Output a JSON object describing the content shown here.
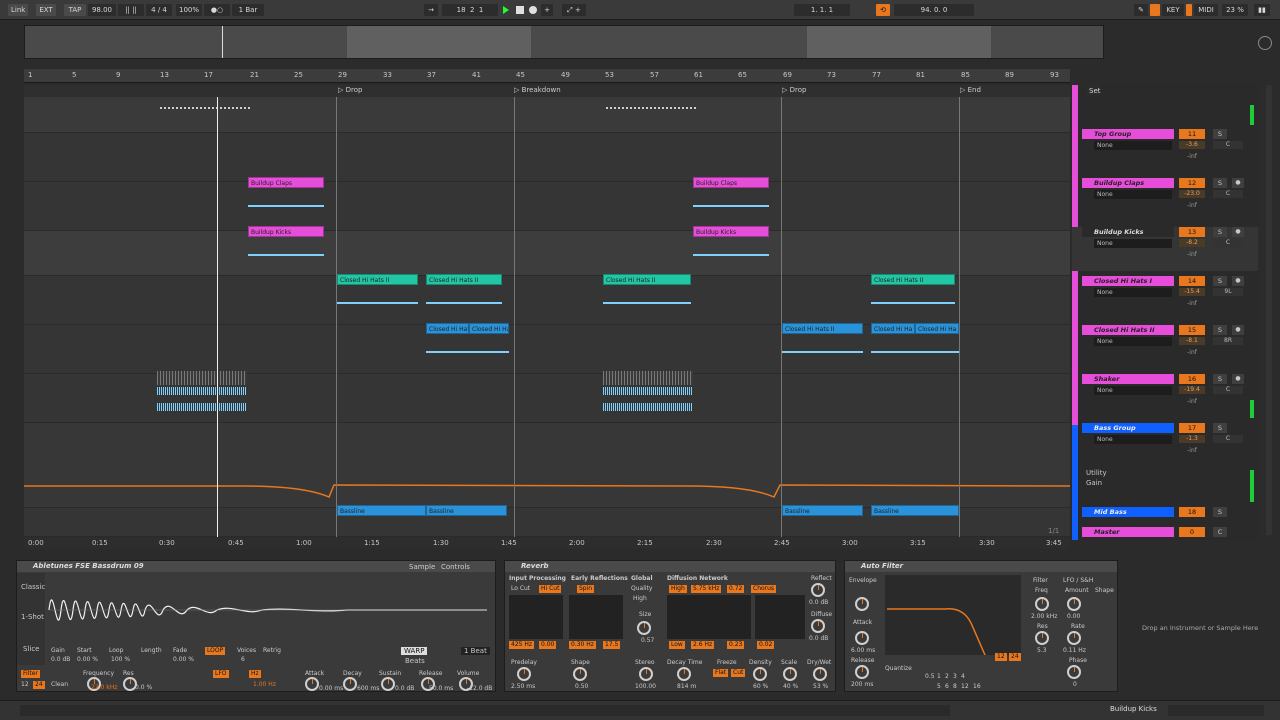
{
  "transport": {
    "link": "Link",
    "ext": "EXT",
    "tap": "TAP",
    "tempo": "98.00",
    "sig": "4 / 4",
    "zoom": "100%",
    "quant": "1 Bar",
    "pos1": "18",
    "pos2": "2",
    "pos3": "1",
    "loopstart": "1.   1.   1",
    "looplen": "94.   0.   0",
    "key": "KEY",
    "midi": "MIDI",
    "cpu": "23 %"
  },
  "ruler": {
    "bars": [
      "1",
      "5",
      "9",
      "13",
      "17",
      "21",
      "25",
      "29",
      "33",
      "37",
      "41",
      "45",
      "49",
      "53",
      "57",
      "61",
      "65",
      "69",
      "73",
      "77",
      "81",
      "85",
      "89",
      "93"
    ]
  },
  "locators": [
    "Drop",
    "Breakdown",
    "Drop",
    "End"
  ],
  "timeruler": [
    "0:00",
    "0:15",
    "0:30",
    "0:45",
    "1:00",
    "1:15",
    "1:30",
    "1:45",
    "2:00",
    "2:15",
    "2:30",
    "2:45",
    "3:00",
    "3:15",
    "3:30",
    "3:45"
  ],
  "clips": {
    "buildup_claps": "Buildup Claps",
    "buildup_kicks": "Buildup Kicks",
    "closed1": "Closed Hi Hats II",
    "closed2": "Closed Hi Hats II",
    "closed2b": "Closed Hi Hats II",
    "closed_hi_hat": "Closed Hi Hat",
    "closed_hi_ha": "Closed Hi Ha",
    "bassline": "Bassline"
  },
  "mixer": {
    "tracks": [
      {
        "name": "Top Group",
        "num": "11",
        "vol": "-3.6",
        "pan": "C",
        "color": "pink"
      },
      {
        "name": "Buildup Claps",
        "num": "12",
        "vol": "-23.0",
        "pan": "C",
        "color": "pink"
      },
      {
        "name": "Buildup Kicks",
        "num": "13",
        "vol": "-8.2",
        "pan": "C",
        "color": "none"
      },
      {
        "name": "Closed Hi Hats I",
        "num": "14",
        "vol": "-15.4",
        "pan": "9L",
        "color": "pink"
      },
      {
        "name": "Closed Hi Hats II",
        "num": "15",
        "vol": "-8.1",
        "pan": "8R",
        "color": "pink"
      },
      {
        "name": "Shaker",
        "num": "16",
        "vol": "-19.4",
        "pan": "C",
        "color": "pink"
      },
      {
        "name": "Bass Group",
        "num": "17",
        "vol": "-1.3",
        "pan": "C",
        "color": "blue"
      }
    ],
    "none": "None",
    "inf": "-inf",
    "solo": "S",
    "utility": "Utility",
    "gain": "Gain",
    "mid_bass": "Mid Bass",
    "mid_bass_num": "18",
    "master": "Master",
    "master_num": "0",
    "master_pan": "C",
    "set": "Set",
    "fraction": "1/1"
  },
  "simpler": {
    "title": "Abletunes FSE Bassdrum 09",
    "tab_sample": "Sample",
    "tab_controls": "Controls",
    "classic": "Classic",
    "oneshot": "1-Shot",
    "slice": "Slice",
    "gain": "Gain",
    "start": "Start",
    "loop": "Loop",
    "length": "Length",
    "fade": "Fade",
    "loop_btn": "LOOP",
    "voices": "Voices",
    "retrig": "Retrig",
    "warp": "WARP",
    "beat": "1 Beat",
    "beats": "Beats",
    "gain_v": "0.0 dB",
    "start_v": "0.00 %",
    "length_v": "100 %",
    "fade_v": "0.00 %",
    "voices_v": "6",
    "filter": "Filter",
    "frequency": "Frequency",
    "res": "Res",
    "clean": "Clean",
    "freq_v": "22.0 kHz",
    "res_v": "0.0 %",
    "lfo": "LFO",
    "hz": "Hz",
    "lfo_v": "1.00 Hz",
    "attack": "Attack",
    "decay": "Decay",
    "sustain": "Sustain",
    "release": "Release",
    "volume": "Volume",
    "attack_v": "0.00 ms",
    "decay_v": "600 ms",
    "sustain_v": "0.0 dB",
    "release_v": "50.0 ms",
    "volume_v": "-12.0 dB",
    "f12": "12",
    "f24": "24"
  },
  "reverb": {
    "title": "Reverb",
    "input": "Input Processing",
    "locut": "Lo Cut",
    "hicut": "Hi Cut",
    "early": "Early Reflections",
    "spin": "Spin",
    "global": "Global",
    "quality": "Quality",
    "high": "High",
    "size": "Size",
    "size_v": "0.57",
    "diffusion": "Diffusion Network",
    "high2": "High",
    "dnv": "5.75 kHz",
    "dnv2": "0.72",
    "chorus": "Chorus",
    "reflect": "Reflect",
    "reflect_v": "0.0 dB",
    "diffuse": "Diffuse",
    "diffuse_v": "0.0 dB",
    "low": "Low",
    "lowv": "2.6 Hz",
    "low2": "0.23",
    "lowq": "0.02",
    "inv1": "425 Hz",
    "inv2": "0.00",
    "inv3": "0.30 Hz",
    "inv4": "17.5",
    "predelay": "Predelay",
    "predelay_v": "2.50 ms",
    "shape": "Shape",
    "shape_v": "0.50",
    "stereo": "Stereo",
    "stereo_v": "100.00",
    "decay": "Decay Time",
    "decay_v": "814 m",
    "freeze": "Freeze",
    "flat": "Flat",
    "cut": "Cut",
    "density": "Density",
    "density_v": "60 %",
    "scale": "Scale",
    "scale_v": "40 %",
    "drywet": "Dry/Wet",
    "drywet_v": "53 %"
  },
  "autofilter": {
    "title": "Auto Filter",
    "envelope": "Envelope",
    "attack": "Attack",
    "attack_v": "6.00 ms",
    "release": "Release",
    "release_v": "200 ms",
    "filter": "Filter",
    "freq": "Freq",
    "freq_v": "2.00 kHz",
    "res": "Res",
    "res_v": "5.3",
    "lfo": "LFO / S&H",
    "amount": "Amount",
    "amount_v": "0.00",
    "rate": "Rate",
    "rate_v": "0.11 Hz",
    "phase": "Phase",
    "phase_v": "0",
    "shape": "Shape",
    "quantize": "Quantize",
    "q": [
      "0.5",
      "1",
      "2",
      "3",
      "4",
      "5",
      "6",
      "8",
      "12",
      "16"
    ],
    "f12": "12",
    "f24": "24"
  },
  "dropzone": "Drop an Instrument or Sample Here",
  "status": {
    "track": "Buildup Kicks"
  }
}
